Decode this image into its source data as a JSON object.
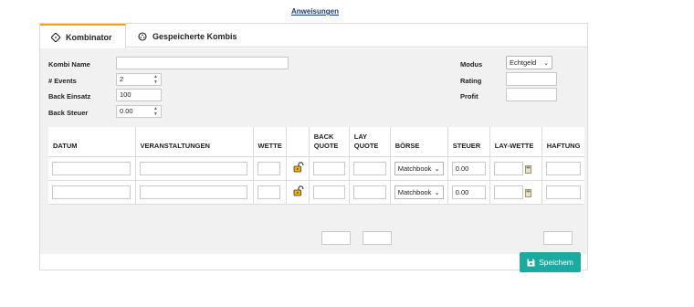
{
  "top_link": "Anweisungen",
  "tabs": [
    {
      "label": "Kombinator",
      "icon": "dice-icon"
    },
    {
      "label": "Gespeicherte Kombis",
      "icon": "dice-icon"
    }
  ],
  "form": {
    "kombi_name_label": "Kombi Name",
    "kombi_name_value": "",
    "events_label": "# Events",
    "events_value": "2",
    "back_einsatz_label": "Back Einsatz",
    "back_einsatz_value": "100",
    "back_steuer_label": "Back Steuer",
    "back_steuer_value": "0.00",
    "modus_label": "Modus",
    "modus_value": "Echtgeld",
    "rating_label": "Rating",
    "rating_value": "",
    "profit_label": "Profit",
    "profit_value": ""
  },
  "table": {
    "headers": [
      "DATUM",
      "VERANSTALTUNGEN",
      "WETTE",
      "",
      "BACK QUOTE",
      "LAY QUOTE",
      "BÖRSE",
      "STEUER",
      "LAY-WETTE",
      "HAFTUNG"
    ],
    "rows": [
      {
        "boerse": "Matchbook",
        "steuer": "0.00"
      },
      {
        "boerse": "Matchbook",
        "steuer": "0.00"
      }
    ]
  },
  "save_label": "Speichem",
  "colors": {
    "accent": "#f0a31a",
    "button": "#1aaaa0",
    "link": "#1a3f7a"
  }
}
